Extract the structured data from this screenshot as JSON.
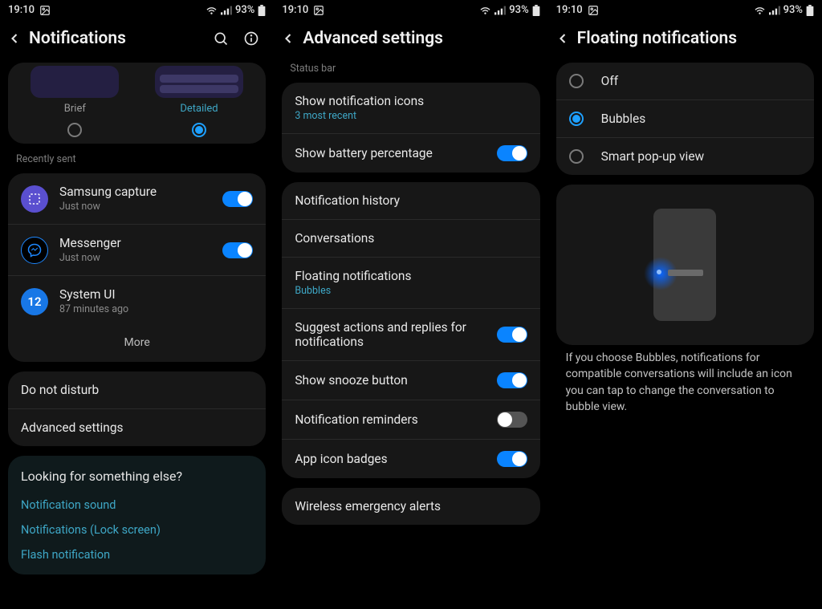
{
  "status": {
    "time": "19:10",
    "battery": "93%"
  },
  "screen1": {
    "title": "Notifications",
    "style": {
      "brief": "Brief",
      "detailed": "Detailed"
    },
    "recently_sent_header": "Recently sent",
    "apps": [
      {
        "name": "Samsung capture",
        "time": "Just now"
      },
      {
        "name": "Messenger",
        "time": "Just now"
      },
      {
        "name": "System UI",
        "time": "87 minutes ago"
      }
    ],
    "more": "More",
    "dnd": "Do not disturb",
    "advanced": "Advanced settings",
    "looking": {
      "title": "Looking for something else?",
      "links": [
        "Notification sound",
        "Notifications (Lock screen)",
        "Flash notification"
      ]
    }
  },
  "screen2": {
    "title": "Advanced settings",
    "section_status_bar": "Status bar",
    "show_icons": {
      "label": "Show notification icons",
      "sub": "3 most recent"
    },
    "show_battery": "Show battery percentage",
    "items": {
      "history": "Notification history",
      "conversations": "Conversations",
      "floating": {
        "label": "Floating notifications",
        "sub": "Bubbles"
      },
      "suggest": "Suggest actions and replies for notifications",
      "snooze": "Show snooze button",
      "reminders": "Notification reminders",
      "badges": "App icon badges"
    },
    "wireless": "Wireless emergency alerts"
  },
  "screen3": {
    "title": "Floating notifications",
    "options": {
      "off": "Off",
      "bubbles": "Bubbles",
      "smart": "Smart pop-up view"
    },
    "description": "If you choose Bubbles, notifications for compatible conversations will include an icon you can tap to change the conversation to bubble view."
  }
}
